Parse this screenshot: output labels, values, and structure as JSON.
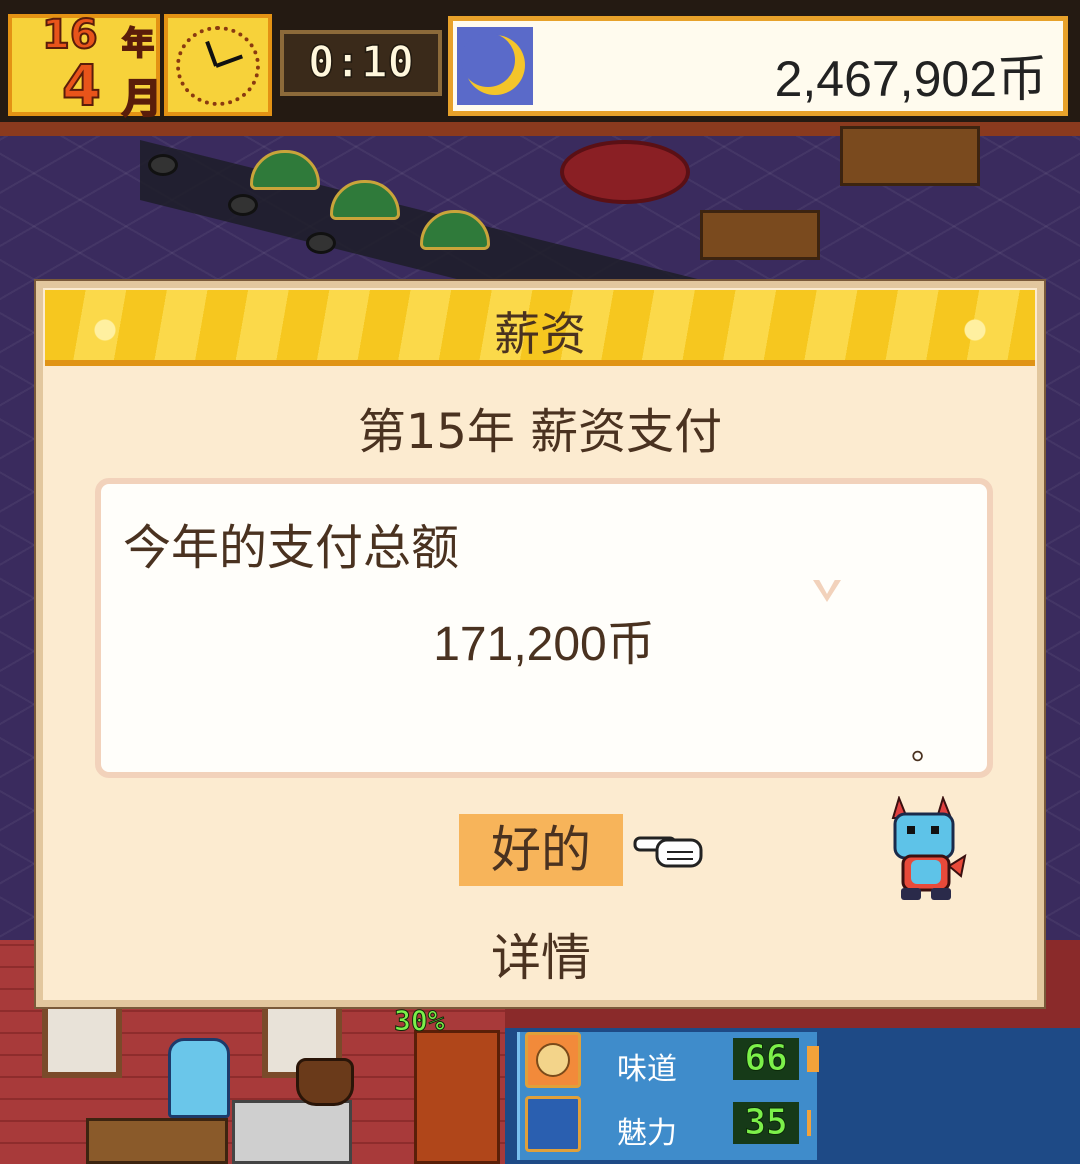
{
  "hud": {
    "year_num": "16",
    "year_label": "年",
    "month_num": "4",
    "month_label": "月",
    "time": "0:10",
    "money": "2,467,902币",
    "clock_icon": "clock-icon",
    "night_icon": "crescent-moon-icon"
  },
  "dialog": {
    "title": "薪资",
    "subtitle": "第15年 薪资支付",
    "message_label": "今年的支付总额",
    "message_amount": "171,200币",
    "message_end": "。",
    "ok_label": "好的",
    "details_label": "详情",
    "pointer_icon": "pointing-hand-icon",
    "character_icon": "blue-dragon-mascot-icon"
  },
  "stats": {
    "items": [
      {
        "label": "味道",
        "value": "66",
        "icon": "smiley-face-icon",
        "bar_level": 0.04
      },
      {
        "label": "魅力",
        "value": "35",
        "icon": "dish-sparkle-icon",
        "bar_level": 0.01
      }
    ],
    "shelf_badge": "30%"
  },
  "colors": {
    "accent_gold": "#f6c71f",
    "dialog_bg": "#fcebd0",
    "text_brown": "#4a3220",
    "ok_highlight": "#f7b45a",
    "stat_green": "#7cf04a"
  }
}
